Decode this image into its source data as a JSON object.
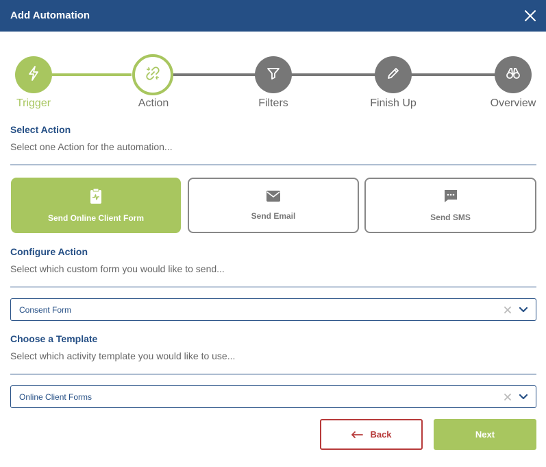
{
  "header": {
    "title": "Add Automation",
    "close_icon": "close-icon"
  },
  "stepper": {
    "steps": [
      {
        "label": "Trigger",
        "icon": "lightning-icon",
        "state": "done"
      },
      {
        "label": "Action",
        "icon": "link-icon",
        "state": "active"
      },
      {
        "label": "Filters",
        "icon": "filter-icon",
        "state": "pending"
      },
      {
        "label": "Finish Up",
        "icon": "pencil-icon",
        "state": "pending"
      },
      {
        "label": "Overview",
        "icon": "binoculars-icon",
        "state": "pending"
      }
    ]
  },
  "select_action": {
    "title": "Select Action",
    "subtitle": "Select one Action for the automation...",
    "options": [
      {
        "label": "Send Online Client Form",
        "icon": "clipboard-icon",
        "selected": true
      },
      {
        "label": "Send Email",
        "icon": "envelope-icon",
        "selected": false
      },
      {
        "label": "Send SMS",
        "icon": "sms-icon",
        "selected": false
      }
    ]
  },
  "configure_action": {
    "title": "Configure Action",
    "subtitle": "Select which custom form you would like to send...",
    "value": "Consent Form"
  },
  "choose_template": {
    "title": "Choose a Template",
    "subtitle": "Select which activity template you would like to use...",
    "value": "Online Client Forms"
  },
  "footer": {
    "back_label": "Back",
    "next_label": "Next"
  },
  "colors": {
    "brand": "#254f85",
    "accent": "#a8c65f",
    "danger": "#b73a3a",
    "inactive": "#777777"
  }
}
